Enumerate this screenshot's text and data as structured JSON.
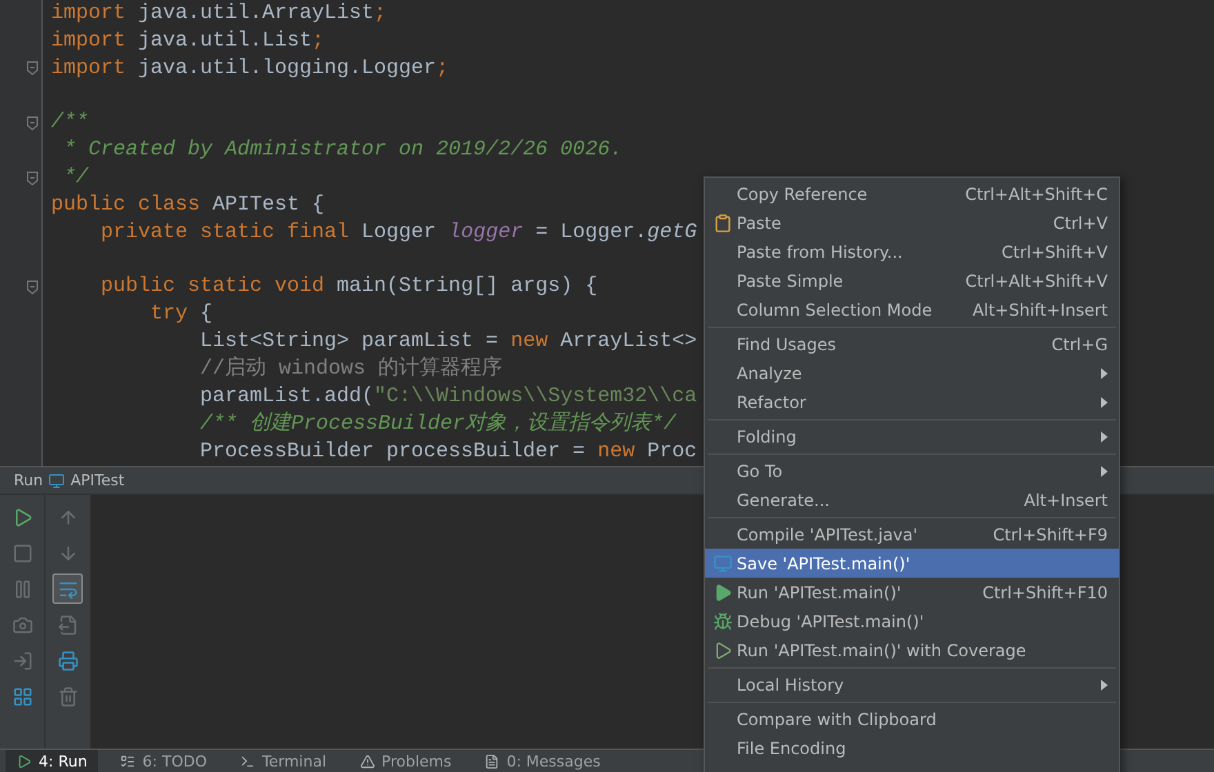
{
  "editor": {
    "lines": [
      {
        "fold": false,
        "tokens": [
          {
            "kind": "kw",
            "text": "import"
          },
          {
            "kind": "plain",
            "text": " java.util.ArrayList"
          },
          {
            "kind": "kw",
            "text": ";"
          }
        ]
      },
      {
        "fold": false,
        "tokens": [
          {
            "kind": "kw",
            "text": "import"
          },
          {
            "kind": "plain",
            "text": " java.util.List"
          },
          {
            "kind": "kw",
            "text": ";"
          }
        ]
      },
      {
        "fold": true,
        "tokens": [
          {
            "kind": "kw",
            "text": "import"
          },
          {
            "kind": "plain",
            "text": " java.util.logging.Logger"
          },
          {
            "kind": "kw",
            "text": ";"
          }
        ]
      },
      {
        "fold": false
      },
      {
        "fold": true,
        "tokens": [
          {
            "kind": "doc",
            "text": "/**"
          }
        ]
      },
      {
        "fold": false,
        "tokens": [
          {
            "kind": "doc",
            "text": " * Created by Administrator on 2019/2/26 0026."
          }
        ]
      },
      {
        "fold": true,
        "tokens": [
          {
            "kind": "doc",
            "text": " */"
          }
        ]
      },
      {
        "fold": false,
        "tokens": [
          {
            "kind": "kw",
            "text": "public class"
          },
          {
            "kind": "plain",
            "text": " APITest {"
          }
        ]
      },
      {
        "fold": false,
        "tokens": [
          {
            "kind": "kw",
            "text": "    private static final"
          },
          {
            "kind": "plain",
            "text": " Logger "
          },
          {
            "kind": "field",
            "text": "logger"
          },
          {
            "kind": "plain",
            "text": " = Logger."
          },
          {
            "kind": "call",
            "text": "getG"
          }
        ]
      },
      {
        "fold": false
      },
      {
        "fold": true,
        "tokens": [
          {
            "kind": "kw",
            "text": "    public static void"
          },
          {
            "kind": "plain",
            "text": " main(String[] args) {"
          }
        ]
      },
      {
        "fold": false,
        "tokens": [
          {
            "kind": "kw",
            "text": "        try"
          },
          {
            "kind": "plain",
            "text": " {"
          }
        ]
      },
      {
        "fold": false,
        "tokens": [
          {
            "kind": "plain",
            "text": "            List<String> paramList = "
          },
          {
            "kind": "kw",
            "text": "new"
          },
          {
            "kind": "plain",
            "text": " ArrayList<>"
          }
        ]
      },
      {
        "fold": false,
        "tokens": [
          {
            "kind": "comment",
            "text": "            //启动 windows 的计算器程序"
          }
        ]
      },
      {
        "fold": false,
        "tokens": [
          {
            "kind": "plain",
            "text": "            paramList.add("
          },
          {
            "kind": "string",
            "text": "\"C:\\\\Windows\\\\System32\\\\ca"
          }
        ]
      },
      {
        "fold": false,
        "tokens": [
          {
            "kind": "doc",
            "text": "            /** 创建ProcessBuilder对象，设置指令列表*/"
          }
        ]
      },
      {
        "fold": false,
        "tokens": [
          {
            "kind": "plain",
            "text": "            ProcessBuilder processBuilder = "
          },
          {
            "kind": "kw",
            "text": "new"
          },
          {
            "kind": "plain",
            "text": " Proc"
          }
        ]
      }
    ]
  },
  "context_menu": {
    "items": [
      {
        "kind": "item",
        "label": "Copy Reference",
        "shortcut": "Ctrl+Alt+Shift+C",
        "submenu": false,
        "selected": false
      },
      {
        "kind": "item",
        "label": "Paste",
        "shortcut": "Ctrl+V",
        "submenu": false,
        "selected": false
      },
      {
        "kind": "item",
        "label": "Paste from History...",
        "shortcut": "Ctrl+Shift+V",
        "submenu": false,
        "selected": false
      },
      {
        "kind": "item",
        "label": "Paste Simple",
        "shortcut": "Ctrl+Alt+Shift+V",
        "submenu": false,
        "selected": false
      },
      {
        "kind": "item",
        "label": "Column Selection Mode",
        "shortcut": "Alt+Shift+Insert",
        "submenu": false,
        "selected": false
      },
      {
        "kind": "separator"
      },
      {
        "kind": "item",
        "label": "Find Usages",
        "shortcut": "Ctrl+G",
        "submenu": false,
        "selected": false
      },
      {
        "kind": "item",
        "label": "Analyze",
        "submenu": true,
        "selected": false
      },
      {
        "kind": "item",
        "label": "Refactor",
        "submenu": true,
        "selected": false
      },
      {
        "kind": "separator"
      },
      {
        "kind": "item",
        "label": "Folding",
        "submenu": true,
        "selected": false
      },
      {
        "kind": "separator"
      },
      {
        "kind": "item",
        "label": "Go To",
        "submenu": true,
        "selected": false
      },
      {
        "kind": "item",
        "label": "Generate...",
        "shortcut": "Alt+Insert",
        "submenu": false,
        "selected": false
      },
      {
        "kind": "separator"
      },
      {
        "kind": "item",
        "label": "Compile 'APITest.java'",
        "shortcut": "Ctrl+Shift+F9",
        "submenu": false,
        "selected": false
      },
      {
        "kind": "item",
        "label": "Save 'APITest.main()'",
        "submenu": false,
        "selected": true
      },
      {
        "kind": "item",
        "label": "Run 'APITest.main()'",
        "shortcut": "Ctrl+Shift+F10",
        "submenu": false,
        "selected": false
      },
      {
        "kind": "item",
        "label": "Debug 'APITest.main()'",
        "submenu": false,
        "selected": false
      },
      {
        "kind": "item",
        "label": "Run 'APITest.main()' with Coverage",
        "submenu": false,
        "selected": false
      },
      {
        "kind": "separator"
      },
      {
        "kind": "item",
        "label": "Local History",
        "submenu": true,
        "selected": false
      },
      {
        "kind": "separator"
      },
      {
        "kind": "item",
        "label": "Compare with Clipboard",
        "submenu": false,
        "selected": false
      },
      {
        "kind": "item",
        "label": "File Encoding",
        "submenu": false,
        "selected": false
      }
    ]
  },
  "run_panel": {
    "title": "Run",
    "config": "APITest",
    "toolbar_left": [
      {
        "disabled": false,
        "pressed": false
      },
      {
        "disabled": true,
        "pressed": false
      },
      {
        "disabled": true,
        "pressed": false
      },
      {
        "disabled": true,
        "pressed": false
      },
      {
        "disabled": true,
        "pressed": false
      },
      {
        "disabled": false,
        "pressed": false
      }
    ],
    "toolbar_right": [
      {
        "disabled": true,
        "pressed": false
      },
      {
        "disabled": true,
        "pressed": false
      },
      {
        "disabled": false,
        "pressed": true
      },
      {
        "disabled": true,
        "pressed": false
      },
      {
        "disabled": false,
        "pressed": false
      },
      {
        "disabled": true,
        "pressed": false
      }
    ]
  },
  "tool_tabs": [
    {
      "label": "4: Run",
      "selected": true
    },
    {
      "label": "6: TODO",
      "selected": false
    },
    {
      "label": "Terminal",
      "selected": false
    },
    {
      "label": "Problems",
      "selected": false
    },
    {
      "label": "0: Messages",
      "selected": false
    }
  ]
}
